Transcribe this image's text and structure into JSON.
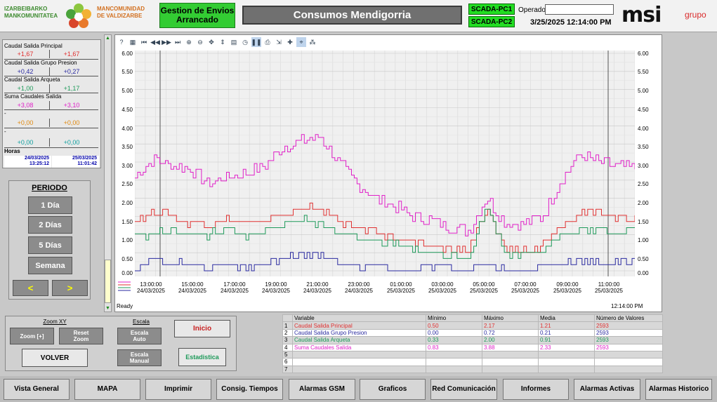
{
  "header": {
    "org_left_1": "IZARBEIBARKO",
    "org_left_2": "MANKOMUNITATEA",
    "org_right_1": "MANCOMUNIDAD",
    "org_right_2": "DE VALDIZARBE",
    "gestion_line1": "Gestion de Envios",
    "gestion_line2": "Arrancado",
    "title": "Consumos Mendigorria",
    "scada_pc1": "SCADA-PC1",
    "scada_pc2": "SCADA-PC2",
    "operador_label": "Operador",
    "operador_value": "",
    "datetime": "3/25/2025 12:14:00 PM",
    "brand": "msi",
    "brand_suffix": "grupo"
  },
  "stats": {
    "rows": [
      {
        "name": "Caudal Salida Principal",
        "left": "+1,67",
        "right": "+1,67",
        "color": "#e03030"
      },
      {
        "name": "Caudal Salida Grupo Presion",
        "left": "+0,42",
        "right": "+0,27",
        "color": "#2a2aa0"
      },
      {
        "name": "Caudal Salida Arqueta",
        "left": "+1,00",
        "right": "+1,17",
        "color": "#1e9a5a"
      },
      {
        "name": "Suma Caudales Salida",
        "left": "+3,08",
        "right": "+3,10",
        "color": "#e020c8"
      },
      {
        "name": "-",
        "left": "+0,00",
        "right": "+0,00",
        "color": "#e08a10"
      },
      {
        "name": "-",
        "left": "+0,00",
        "right": "+0,00",
        "color": "#10a0a0"
      }
    ],
    "horas_label": "Horas",
    "start_date": "24/03/2025",
    "start_time": "13:25:12",
    "end_date": "25/03/2025",
    "end_time": "11:01:42"
  },
  "periodo": {
    "title": "PERIODO",
    "buttons": [
      "1 Día",
      "2 Días",
      "5 Días",
      "Semana"
    ],
    "prev": "<",
    "next": ">"
  },
  "chart_data": {
    "type": "line",
    "ylim": [
      0,
      6
    ],
    "y_ticks": [
      "6.00",
      "5.50",
      "5.00",
      "4.50",
      "4.00",
      "3.50",
      "3.00",
      "2.50",
      "2.00",
      "1.50",
      "1.00",
      "0.50",
      "0.00"
    ],
    "x_ticks": [
      {
        "time": "13:00:00",
        "date": "24/03/2025"
      },
      {
        "time": "15:00:00",
        "date": "24/03/2025"
      },
      {
        "time": "17:00:00",
        "date": "24/03/2025"
      },
      {
        "time": "19:00:00",
        "date": "24/03/2025"
      },
      {
        "time": "21:00:00",
        "date": "24/03/2025"
      },
      {
        "time": "23:00:00",
        "date": "24/03/2025"
      },
      {
        "time": "01:00:00",
        "date": "25/03/2025"
      },
      {
        "time": "03:00:00",
        "date": "25/03/2025"
      },
      {
        "time": "05:00:00",
        "date": "25/03/2025"
      },
      {
        "time": "07:00:00",
        "date": "25/03/2025"
      },
      {
        "time": "09:00:00",
        "date": "25/03/2025"
      },
      {
        "time": "11:00:00",
        "date": "25/03/2025"
      }
    ],
    "x_hours": [
      0,
      1,
      2,
      3,
      4,
      5,
      6,
      7,
      8,
      9,
      10,
      11,
      12,
      13,
      14,
      15,
      16,
      17,
      18,
      19,
      20,
      21,
      22,
      23,
      24
    ],
    "series": [
      {
        "name": "Suma Caudales Salida",
        "color": "#e020c8",
        "values": [
          2.6,
          3.1,
          2.9,
          2.8,
          2.4,
          2.6,
          2.7,
          2.9,
          3.4,
          3.6,
          3.7,
          3.0,
          2.4,
          2.0,
          1.8,
          1.5,
          1.4,
          1.2,
          1.1,
          2.0,
          1.3,
          1.3,
          1.5,
          2.5,
          3.2,
          3.0,
          2.9,
          2.8
        ]
      },
      {
        "name": "Caudal Salida Principal",
        "color": "#e03030",
        "values": [
          1.4,
          1.6,
          1.5,
          1.3,
          1.3,
          1.4,
          1.3,
          1.4,
          1.6,
          1.7,
          1.7,
          1.4,
          1.2,
          1.0,
          0.9,
          0.8,
          0.7,
          0.6,
          0.6,
          1.6,
          0.6,
          0.6,
          0.7,
          1.3,
          1.6,
          1.6,
          1.5,
          1.5
        ]
      },
      {
        "name": "Caudal Salida Arqueta",
        "color": "#1e9a5a",
        "values": [
          1.0,
          1.0,
          1.1,
          1.0,
          1.0,
          1.1,
          1.0,
          1.1,
          1.3,
          1.4,
          1.3,
          1.1,
          0.9,
          0.8,
          0.7,
          0.6,
          0.5,
          0.4,
          0.4,
          1.8,
          0.5,
          0.5,
          0.6,
          1.0,
          1.1,
          1.1,
          1.1,
          1.2
        ]
      },
      {
        "name": "Caudal Salida Grupo Presion",
        "color": "#2a2aa0",
        "values": [
          0.1,
          0.3,
          0.2,
          0.2,
          0.1,
          0.2,
          0.1,
          0.2,
          0.3,
          0.5,
          0.4,
          0.2,
          0.1,
          0.1,
          0.0,
          0.0,
          0.1,
          0.1,
          0.0,
          0.2,
          0.0,
          0.0,
          0.1,
          0.2,
          0.3,
          0.2,
          0.2,
          0.3
        ]
      }
    ]
  },
  "chart_window": {
    "status_ready": "Ready",
    "status_time": "12:14:00 PM"
  },
  "zoom": {
    "zoom_title": "Zoom XY",
    "zoom_plus": "Zoom [+]",
    "reset_line1": "Reset",
    "reset_line2": "Zoom",
    "volver": "VOLVER",
    "escala_title": "Escala",
    "escala_auto_1": "Escala",
    "escala_auto_2": "Auto",
    "escala_manual_1": "Escala",
    "escala_manual_2": "Manual",
    "inicio": "Inicio",
    "estadistica": "Estadistica"
  },
  "table": {
    "headers": [
      "",
      "Variable",
      "Mínimo",
      "Máximo",
      "Media",
      "Número de Valores"
    ],
    "rows": [
      {
        "n": "1",
        "variable": "Caudal Salida Principal",
        "min": "0.50",
        "max": "2.17",
        "media": "1.21",
        "count": "2593",
        "color": "#e03030"
      },
      {
        "n": "2",
        "variable": "Caudal Salida Grupo Presion",
        "min": "0.00",
        "max": "0.72",
        "media": "0.21",
        "count": "2593",
        "color": "#2a2aa0"
      },
      {
        "n": "3",
        "variable": "Caudal Salida Arqueta",
        "min": "0.33",
        "max": "2.00",
        "media": "0.91",
        "count": "2593",
        "color": "#1e9a5a"
      },
      {
        "n": "4",
        "variable": "Suma Caudales Salida",
        "min": "0.83",
        "max": "3.88",
        "media": "2.33",
        "count": "2593",
        "color": "#e020c8"
      },
      {
        "n": "5",
        "variable": "",
        "min": "",
        "max": "",
        "media": "",
        "count": "",
        "color": "#000000"
      },
      {
        "n": "6",
        "variable": "",
        "min": "",
        "max": "",
        "media": "",
        "count": "",
        "color": "#000000"
      },
      {
        "n": "7",
        "variable": "",
        "min": "",
        "max": "",
        "media": "",
        "count": "",
        "color": "#000000"
      }
    ]
  },
  "nav": {
    "items": [
      "Vista General",
      "MAPA",
      "Imprimir",
      "Consig. Tiempos",
      "Alarmas GSM",
      "Graficos",
      "Red Comunicación",
      "Informes",
      "Alarmas Activas",
      "Alarmas Historico"
    ]
  }
}
